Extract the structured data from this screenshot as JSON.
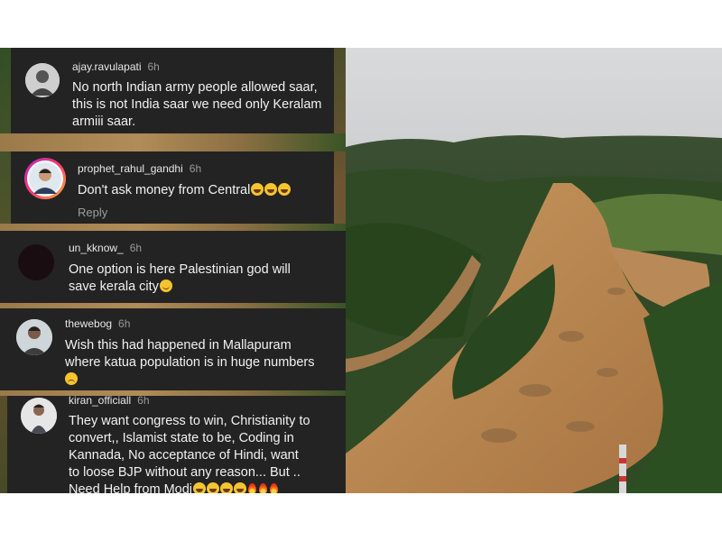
{
  "comments": [
    {
      "username": "ajay.ravulapati",
      "time": "6h",
      "lines": [
        "No north Indian army people allowed saar,",
        "this is not India saar we need only Keralam",
        "armiii saar."
      ]
    },
    {
      "username": "prophet_rahul_gandhi",
      "time": "6h",
      "lines": [
        "Don't ask money from Central"
      ],
      "emoji": [
        "face-with-tears-of-joy",
        "face-with-tears-of-joy",
        "face-with-tears-of-joy"
      ],
      "reply_label": "Reply"
    },
    {
      "username": "un_kknow_",
      "time": "6h",
      "lines": [
        "One option is here Palestinian god will",
        "save kerala city"
      ],
      "emoji": [
        "slightly-smiling-face"
      ]
    },
    {
      "username": "thewebog",
      "time": "6h",
      "lines": [
        "Wish this had happened in Mallapuram",
        "where katua population is in huge numbers"
      ],
      "emoji": [
        "disappointed-face"
      ]
    },
    {
      "username": "kiran_officiall",
      "time": "6h",
      "lines": [
        "They want congress to win, Christianity to",
        "convert,, Islamist state to be,  Coding in",
        "Kannada,  No  acceptance of  Hindi,  want",
        "to loose BJP without any reason... But ..",
        "Need Help from Modi"
      ],
      "emoji": [
        "face-with-tears-of-joy",
        "face-with-tears-of-joy",
        "face-with-tears-of-joy",
        "face-with-tears-of-joy",
        "fire",
        "fire",
        "fire"
      ]
    }
  ],
  "colors": {
    "comment_bg": "#232323",
    "text": "#f2f2f2",
    "meta": "#9a9a9a",
    "emoji_yellow": "#f6c430"
  }
}
